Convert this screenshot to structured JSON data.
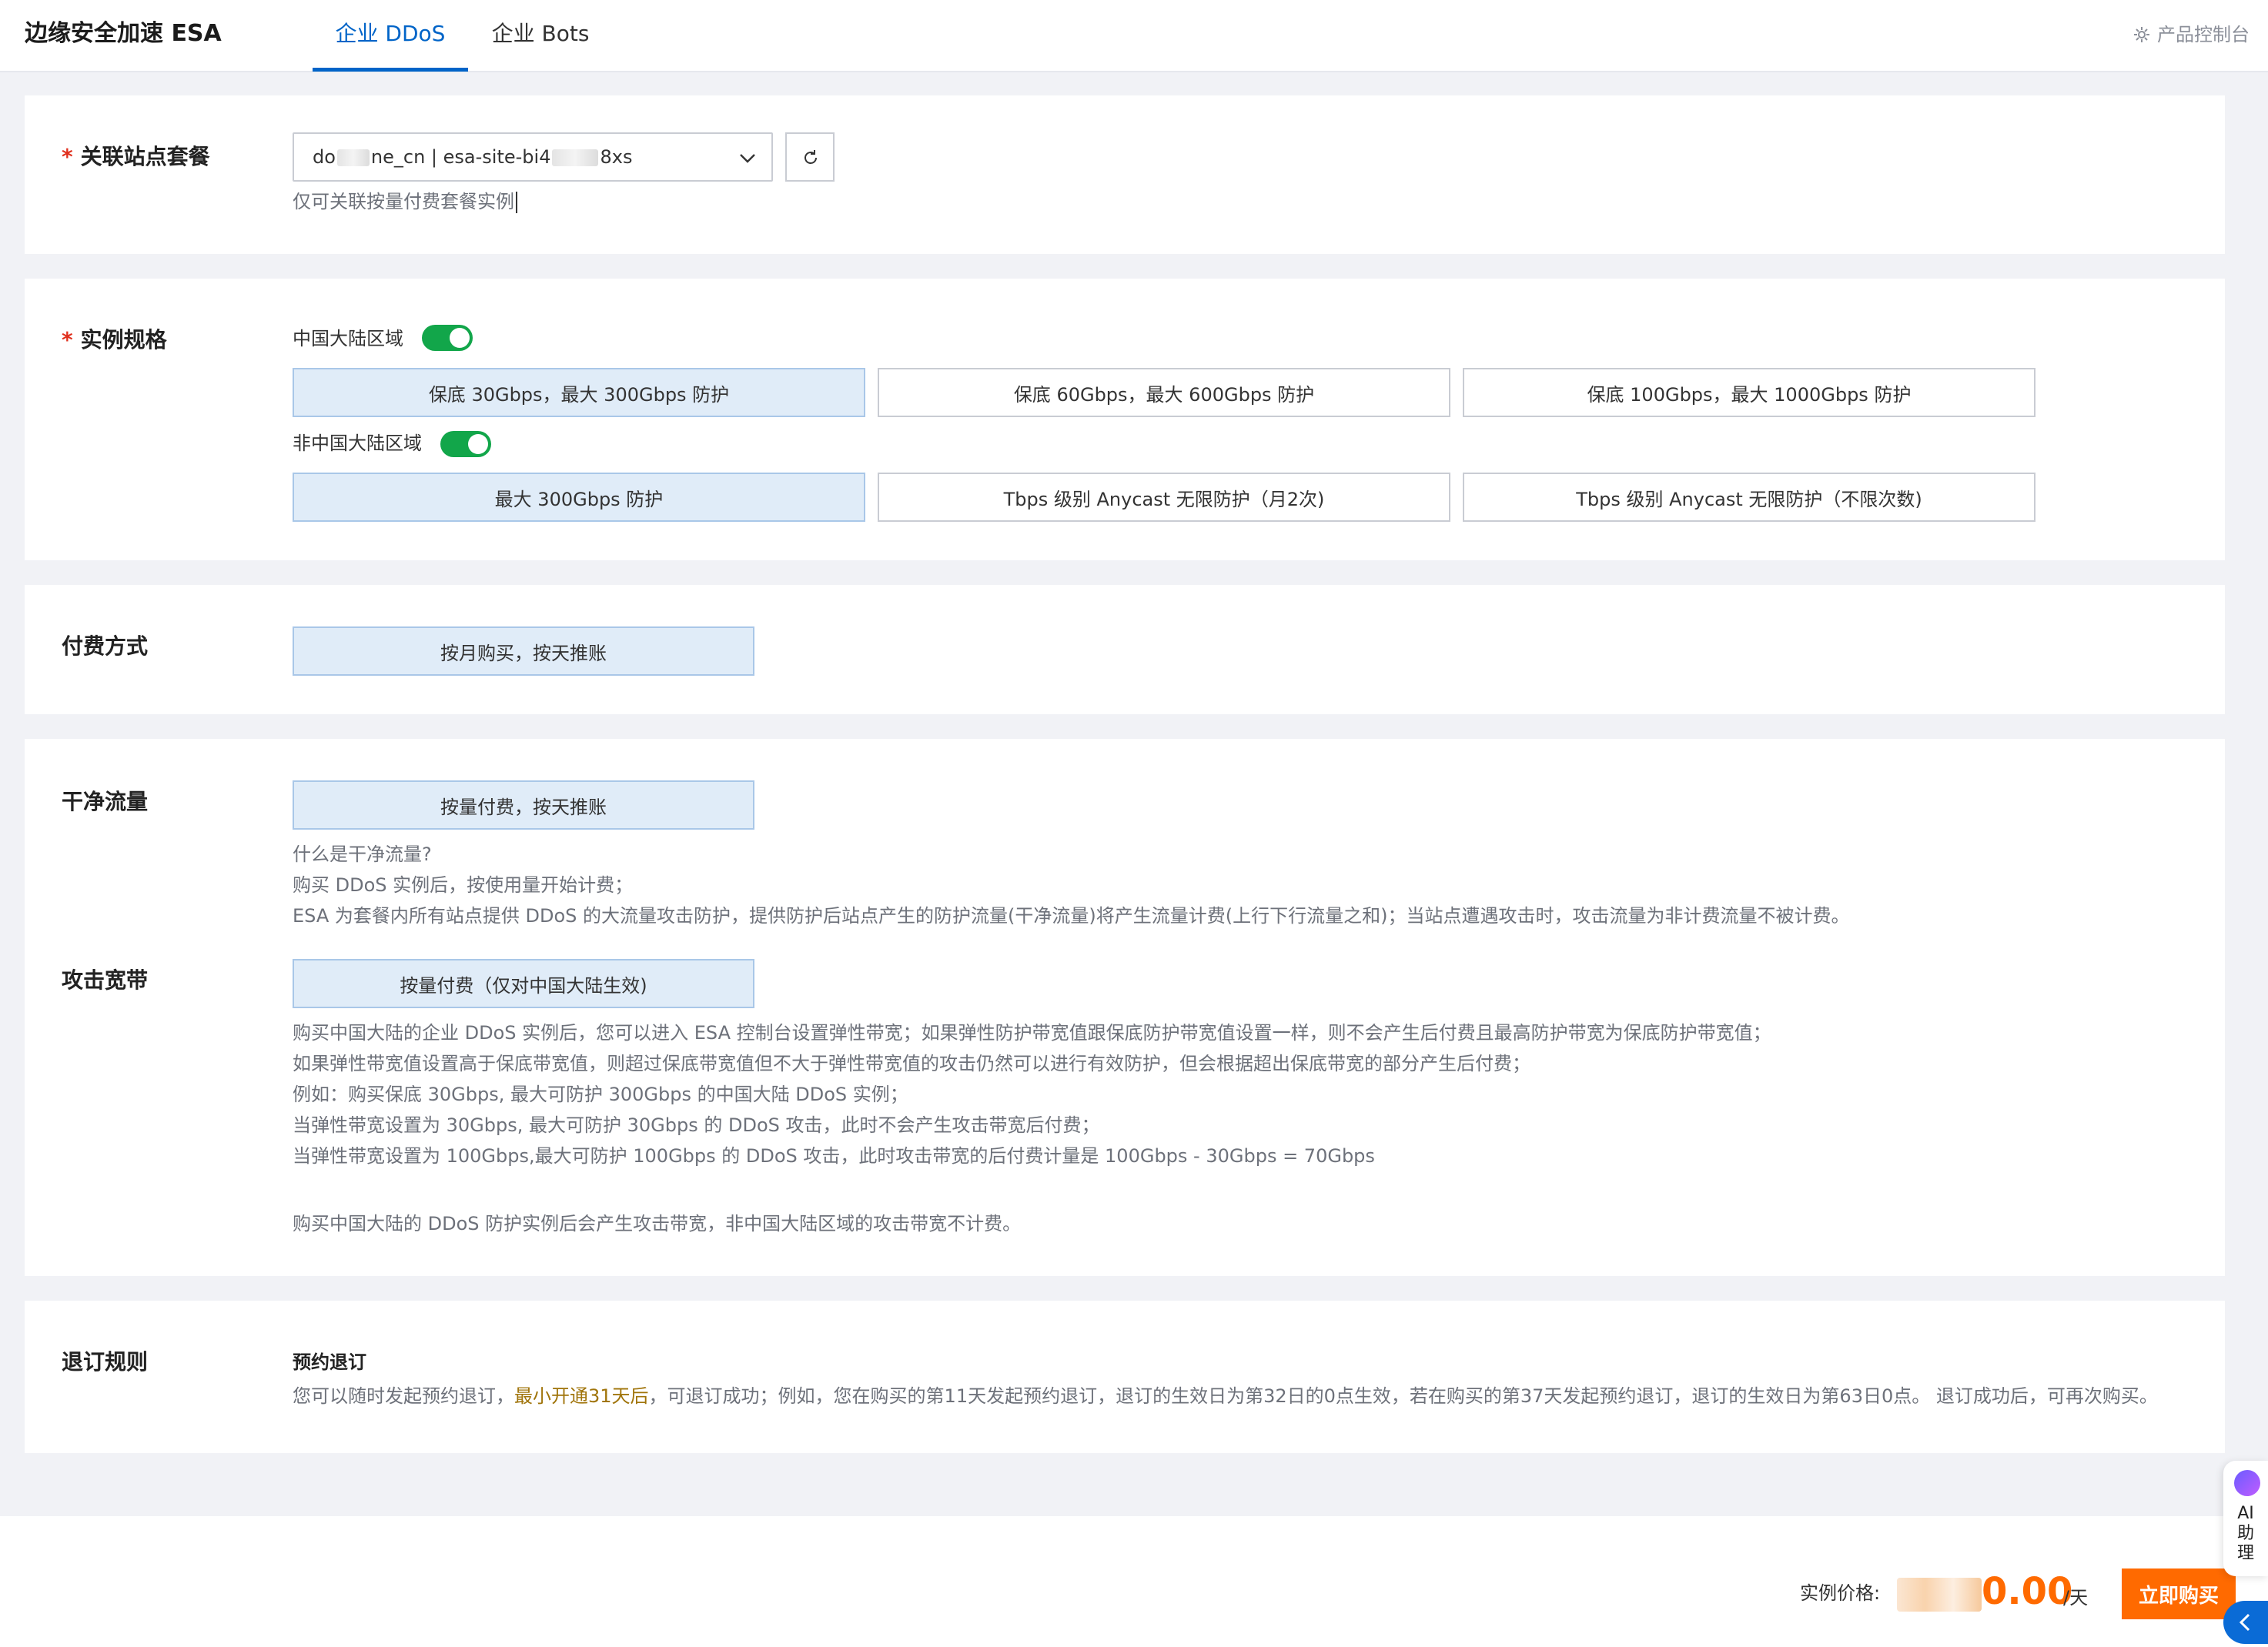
{
  "header": {
    "brand": "边缘安全加速 ESA",
    "tabs": [
      {
        "label": "企业 DDoS",
        "active": true
      },
      {
        "label": "企业 Bots",
        "active": false
      }
    ],
    "console_link": "产品控制台"
  },
  "site_plan": {
    "label": "关联站点套餐",
    "required_mark": "*",
    "select_value_prefix": "do",
    "select_value_middle": "ne_cn | esa-site-bi4",
    "select_value_suffix": "8xs",
    "hint": "仅可关联按量付费套餐实例"
  },
  "instance_spec": {
    "label": "实例规格",
    "required_mark": "*",
    "mainland": {
      "label": "中国大陆区域",
      "enabled": true,
      "options": [
        "保底 30Gbps，最大 300Gbps 防护",
        "保底 60Gbps，最大 600Gbps 防护",
        "保底 100Gbps，最大 1000Gbps 防护"
      ],
      "selected_index": 0
    },
    "overseas": {
      "label": "非中国大陆区域",
      "enabled": true,
      "options": [
        "最大 300Gbps 防护",
        "Tbps 级别 Anycast 无限防护（月2次)",
        "Tbps 级别 Anycast 无限防护（不限次数)"
      ],
      "selected_index": 0
    }
  },
  "billing": {
    "label": "付费方式",
    "option": "按月购买，按天推账"
  },
  "clean_traffic": {
    "label": "干净流量",
    "option": "按量付费，按天推账",
    "lines": [
      "什么是干净流量?",
      "购买 DDoS 实例后，按使用量开始计费；",
      "ESA 为套餐内所有站点提供 DDoS 的大流量攻击防护，提供防护后站点产生的防护流量(干净流量)将产生流量计费(上行下行流量之和)；当站点遭遇攻击时，攻击流量为非计费流量不被计费。"
    ]
  },
  "attack_bandwidth": {
    "label": "攻击宽带",
    "option": "按量付费（仅对中国大陆生效)",
    "lines": [
      "购买中国大陆的企业 DDoS 实例后，您可以进入 ESA 控制台设置弹性带宽；如果弹性防护带宽值跟保底防护带宽值设置一样，则不会产生后付费且最高防护带宽为保底防护带宽值；",
      "如果弹性带宽值设置高于保底带宽值，则超过保底带宽值但不大于弹性带宽值的攻击仍然可以进行有效防护，但会根据超出保底带宽的部分产生后付费；",
      "例如：购买保底 30Gbps, 最大可防护 300Gbps 的中国大陆 DDoS 实例；",
      "当弹性带宽设置为 30Gbps, 最大可防护 30Gbps 的 DDoS 攻击，此时不会产生攻击带宽后付费；",
      "当弹性带宽设置为 100Gbps,最大可防护 100Gbps 的 DDoS 攻击，此时攻击带宽的后付费计量是 100Gbps - 30Gbps = 70Gbps"
    ],
    "note": "购买中国大陆的 DDoS 防护实例后会产生攻击带宽，非中国大陆区域的攻击带宽不计费。"
  },
  "refund": {
    "label": "退订规则",
    "subtitle": "预约退订",
    "text_before": "您可以随时发起预约退订，",
    "text_highlight": "最小开通31天后",
    "text_after": "，可退订成功；例如，您在购买的第11天发起预约退订，退订的生效日为第32日的0点生效，若在购买的第37天发起预约退订，退订的生效日为第63日0点。 退订成功后，可再次购买。"
  },
  "footer": {
    "price_label": "实例价格:",
    "price_value": "0.00",
    "price_unit": "/天",
    "buy_label": "立即购买"
  },
  "assistant": {
    "label_lines": [
      "AI",
      "助",
      "理"
    ]
  },
  "colors": {
    "accent": "#0064c8",
    "toggle_on": "#12a64a",
    "price": "#ff6a00",
    "highlight": "#a0740a"
  }
}
